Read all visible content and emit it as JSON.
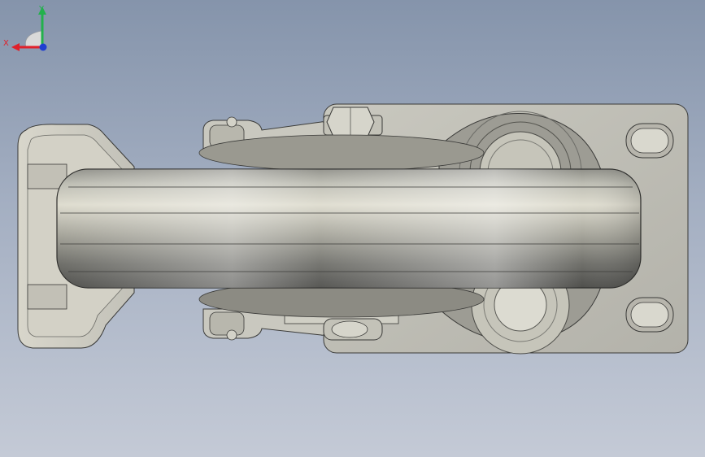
{
  "viewport": {
    "model_name": "caster-wheel-top-view",
    "background_gradient": [
      "#8594ab",
      "#c4cad6"
    ]
  },
  "triad": {
    "x_label": "X",
    "y_label": "Y",
    "x_color": "#e0202a",
    "y_color": "#22b14c",
    "z_color": "#1f3fd1",
    "icon": "coordinate-triad-icon"
  }
}
